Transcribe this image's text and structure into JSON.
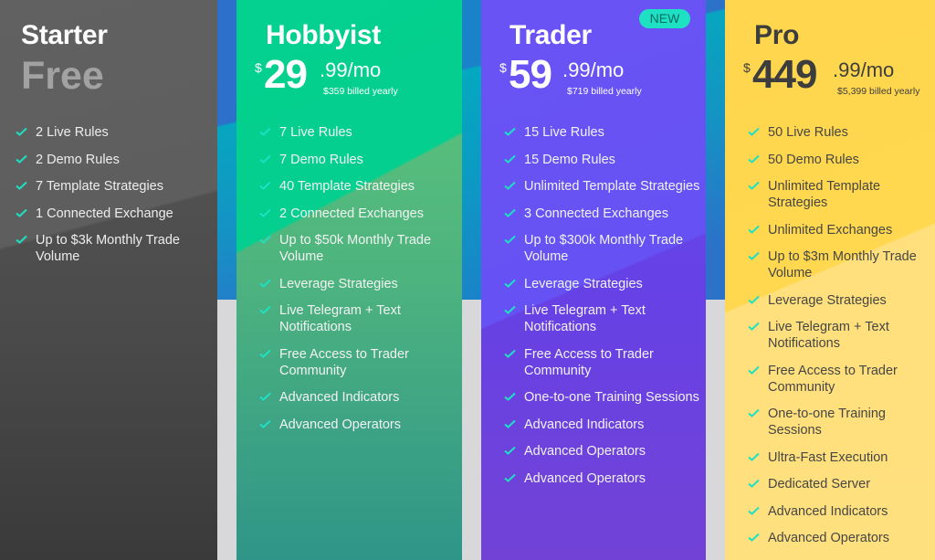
{
  "colors": {
    "check": "#1ee0c3",
    "starter": "#4a4a4a",
    "hobbyist": "#05cf8e",
    "trader": "#6652f4",
    "pro": "#ffd84f",
    "badge": "#1ee0c3"
  },
  "plans": [
    {
      "name": "Starter",
      "price_label": "Free",
      "features": [
        "2 Live Rules",
        "2 Demo Rules",
        "7 Template Strategies",
        "1 Connected Exchange",
        "Up to $3k Monthly Trade Volume"
      ]
    },
    {
      "name": "Hobbyist",
      "currency": "$",
      "price_whole": "29",
      "price_cents": ".99/mo",
      "billed_yearly": "$359 billed yearly",
      "features": [
        "7 Live Rules",
        "7 Demo Rules",
        "40 Template Strategies",
        "2 Connected Exchanges",
        "Up to $50k Monthly Trade Volume",
        "Leverage Strategies",
        "Live Telegram + Text Notifications",
        "Free Access to Trader Community",
        "Advanced Indicators",
        "Advanced Operators"
      ]
    },
    {
      "name": "Trader",
      "badge": "NEW",
      "currency": "$",
      "price_whole": "59",
      "price_cents": ".99/mo",
      "billed_yearly": "$719 billed yearly",
      "features": [
        "15 Live Rules",
        "15 Demo Rules",
        "Unlimited Template Strategies",
        "3 Connected Exchanges",
        "Up to $300k Monthly Trade Volume",
        "Leverage Strategies",
        "Live Telegram + Text Notifications",
        "Free Access to Trader Community",
        "One-to-one Training Sessions",
        "Advanced Indicators",
        "Advanced Operators",
        "Advanced Operators"
      ]
    },
    {
      "name": "Pro",
      "currency": "$",
      "price_whole": "449",
      "price_cents": ".99/mo",
      "billed_yearly": "$5,399 billed yearly",
      "features": [
        "50 Live Rules",
        "50 Demo Rules",
        "Unlimited Template Strategies",
        "Unlimited Exchanges",
        "Up to $3m Monthly Trade Volume",
        "Leverage Strategies",
        "Live Telegram + Text Notifications",
        "Free Access to Trader Community",
        "One-to-one Training Sessions",
        "Ultra-Fast Execution",
        "Dedicated Server",
        "Advanced Indicators",
        "Advanced Operators"
      ]
    }
  ]
}
